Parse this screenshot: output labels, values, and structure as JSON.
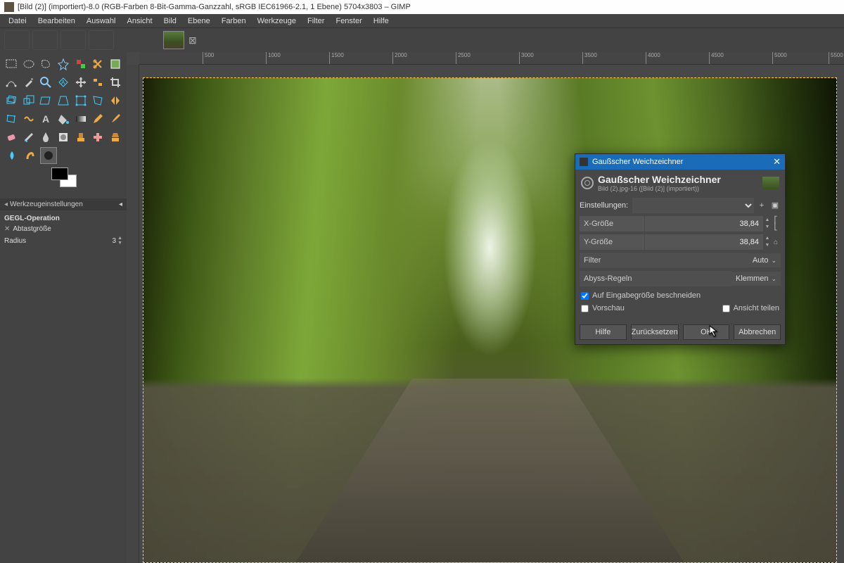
{
  "window": {
    "title": "[Bild (2)] (importiert)-8.0 (RGB-Farben 8-Bit-Gamma-Ganzzahl, sRGB IEC61966-2.1, 1 Ebene) 5704x3803 – GIMP"
  },
  "menu": {
    "items": [
      "Datei",
      "Bearbeiten",
      "Auswahl",
      "Ansicht",
      "Bild",
      "Ebene",
      "Farben",
      "Werkzeuge",
      "Filter",
      "Fenster",
      "Hilfe"
    ]
  },
  "ruler_ticks": [
    "500",
    "1000",
    "1500",
    "2000",
    "2500",
    "3000",
    "3500",
    "4000",
    "4500",
    "5000",
    "5500"
  ],
  "tool_options": {
    "panel_title": "Werkzeugeinstellungen",
    "gegl_label": "GEGL-Operation",
    "abs_label": "Abtastgröße",
    "radius_label": "Radius",
    "radius_value": "3"
  },
  "dialog": {
    "title": "Gaußscher Weichzeichner",
    "heading": "Gaußscher Weichzeichner",
    "subheading": "Bild (2).jpg-16 ([Bild (2)] (importiert))",
    "settings_label": "Einstellungen:",
    "x_label": "X-Größe",
    "x_value": "38,84",
    "y_label": "Y-Größe",
    "y_value": "38,84",
    "filter_label": "Filter",
    "filter_value": "Auto",
    "abyss_label": "Abyss-Regeln",
    "abyss_value": "Klemmen",
    "clip_label": "Auf Eingabegröße beschneiden",
    "clip_checked": true,
    "preview_label": "Vorschau",
    "preview_checked": false,
    "split_label": "Ansicht teilen",
    "split_checked": false,
    "buttons": {
      "help": "Hilfe",
      "reset": "Zurücksetzen",
      "ok": "OK",
      "cancel": "Abbrechen"
    }
  }
}
